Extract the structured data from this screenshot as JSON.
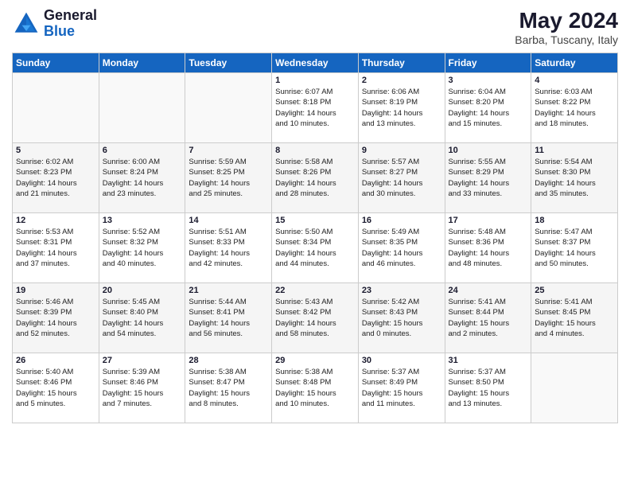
{
  "header": {
    "logo_line1": "General",
    "logo_line2": "Blue",
    "month_year": "May 2024",
    "location": "Barba, Tuscany, Italy"
  },
  "weekdays": [
    "Sunday",
    "Monday",
    "Tuesday",
    "Wednesday",
    "Thursday",
    "Friday",
    "Saturday"
  ],
  "weeks": [
    [
      {
        "day": "",
        "lines": []
      },
      {
        "day": "",
        "lines": []
      },
      {
        "day": "",
        "lines": []
      },
      {
        "day": "1",
        "lines": [
          "Sunrise: 6:07 AM",
          "Sunset: 8:18 PM",
          "Daylight: 14 hours",
          "and 10 minutes."
        ]
      },
      {
        "day": "2",
        "lines": [
          "Sunrise: 6:06 AM",
          "Sunset: 8:19 PM",
          "Daylight: 14 hours",
          "and 13 minutes."
        ]
      },
      {
        "day": "3",
        "lines": [
          "Sunrise: 6:04 AM",
          "Sunset: 8:20 PM",
          "Daylight: 14 hours",
          "and 15 minutes."
        ]
      },
      {
        "day": "4",
        "lines": [
          "Sunrise: 6:03 AM",
          "Sunset: 8:22 PM",
          "Daylight: 14 hours",
          "and 18 minutes."
        ]
      }
    ],
    [
      {
        "day": "5",
        "lines": [
          "Sunrise: 6:02 AM",
          "Sunset: 8:23 PM",
          "Daylight: 14 hours",
          "and 21 minutes."
        ]
      },
      {
        "day": "6",
        "lines": [
          "Sunrise: 6:00 AM",
          "Sunset: 8:24 PM",
          "Daylight: 14 hours",
          "and 23 minutes."
        ]
      },
      {
        "day": "7",
        "lines": [
          "Sunrise: 5:59 AM",
          "Sunset: 8:25 PM",
          "Daylight: 14 hours",
          "and 25 minutes."
        ]
      },
      {
        "day": "8",
        "lines": [
          "Sunrise: 5:58 AM",
          "Sunset: 8:26 PM",
          "Daylight: 14 hours",
          "and 28 minutes."
        ]
      },
      {
        "day": "9",
        "lines": [
          "Sunrise: 5:57 AM",
          "Sunset: 8:27 PM",
          "Daylight: 14 hours",
          "and 30 minutes."
        ]
      },
      {
        "day": "10",
        "lines": [
          "Sunrise: 5:55 AM",
          "Sunset: 8:29 PM",
          "Daylight: 14 hours",
          "and 33 minutes."
        ]
      },
      {
        "day": "11",
        "lines": [
          "Sunrise: 5:54 AM",
          "Sunset: 8:30 PM",
          "Daylight: 14 hours",
          "and 35 minutes."
        ]
      }
    ],
    [
      {
        "day": "12",
        "lines": [
          "Sunrise: 5:53 AM",
          "Sunset: 8:31 PM",
          "Daylight: 14 hours",
          "and 37 minutes."
        ]
      },
      {
        "day": "13",
        "lines": [
          "Sunrise: 5:52 AM",
          "Sunset: 8:32 PM",
          "Daylight: 14 hours",
          "and 40 minutes."
        ]
      },
      {
        "day": "14",
        "lines": [
          "Sunrise: 5:51 AM",
          "Sunset: 8:33 PM",
          "Daylight: 14 hours",
          "and 42 minutes."
        ]
      },
      {
        "day": "15",
        "lines": [
          "Sunrise: 5:50 AM",
          "Sunset: 8:34 PM",
          "Daylight: 14 hours",
          "and 44 minutes."
        ]
      },
      {
        "day": "16",
        "lines": [
          "Sunrise: 5:49 AM",
          "Sunset: 8:35 PM",
          "Daylight: 14 hours",
          "and 46 minutes."
        ]
      },
      {
        "day": "17",
        "lines": [
          "Sunrise: 5:48 AM",
          "Sunset: 8:36 PM",
          "Daylight: 14 hours",
          "and 48 minutes."
        ]
      },
      {
        "day": "18",
        "lines": [
          "Sunrise: 5:47 AM",
          "Sunset: 8:37 PM",
          "Daylight: 14 hours",
          "and 50 minutes."
        ]
      }
    ],
    [
      {
        "day": "19",
        "lines": [
          "Sunrise: 5:46 AM",
          "Sunset: 8:39 PM",
          "Daylight: 14 hours",
          "and 52 minutes."
        ]
      },
      {
        "day": "20",
        "lines": [
          "Sunrise: 5:45 AM",
          "Sunset: 8:40 PM",
          "Daylight: 14 hours",
          "and 54 minutes."
        ]
      },
      {
        "day": "21",
        "lines": [
          "Sunrise: 5:44 AM",
          "Sunset: 8:41 PM",
          "Daylight: 14 hours",
          "and 56 minutes."
        ]
      },
      {
        "day": "22",
        "lines": [
          "Sunrise: 5:43 AM",
          "Sunset: 8:42 PM",
          "Daylight: 14 hours",
          "and 58 minutes."
        ]
      },
      {
        "day": "23",
        "lines": [
          "Sunrise: 5:42 AM",
          "Sunset: 8:43 PM",
          "Daylight: 15 hours",
          "and 0 minutes."
        ]
      },
      {
        "day": "24",
        "lines": [
          "Sunrise: 5:41 AM",
          "Sunset: 8:44 PM",
          "Daylight: 15 hours",
          "and 2 minutes."
        ]
      },
      {
        "day": "25",
        "lines": [
          "Sunrise: 5:41 AM",
          "Sunset: 8:45 PM",
          "Daylight: 15 hours",
          "and 4 minutes."
        ]
      }
    ],
    [
      {
        "day": "26",
        "lines": [
          "Sunrise: 5:40 AM",
          "Sunset: 8:46 PM",
          "Daylight: 15 hours",
          "and 5 minutes."
        ]
      },
      {
        "day": "27",
        "lines": [
          "Sunrise: 5:39 AM",
          "Sunset: 8:46 PM",
          "Daylight: 15 hours",
          "and 7 minutes."
        ]
      },
      {
        "day": "28",
        "lines": [
          "Sunrise: 5:38 AM",
          "Sunset: 8:47 PM",
          "Daylight: 15 hours",
          "and 8 minutes."
        ]
      },
      {
        "day": "29",
        "lines": [
          "Sunrise: 5:38 AM",
          "Sunset: 8:48 PM",
          "Daylight: 15 hours",
          "and 10 minutes."
        ]
      },
      {
        "day": "30",
        "lines": [
          "Sunrise: 5:37 AM",
          "Sunset: 8:49 PM",
          "Daylight: 15 hours",
          "and 11 minutes."
        ]
      },
      {
        "day": "31",
        "lines": [
          "Sunrise: 5:37 AM",
          "Sunset: 8:50 PM",
          "Daylight: 15 hours",
          "and 13 minutes."
        ]
      },
      {
        "day": "",
        "lines": []
      }
    ]
  ]
}
